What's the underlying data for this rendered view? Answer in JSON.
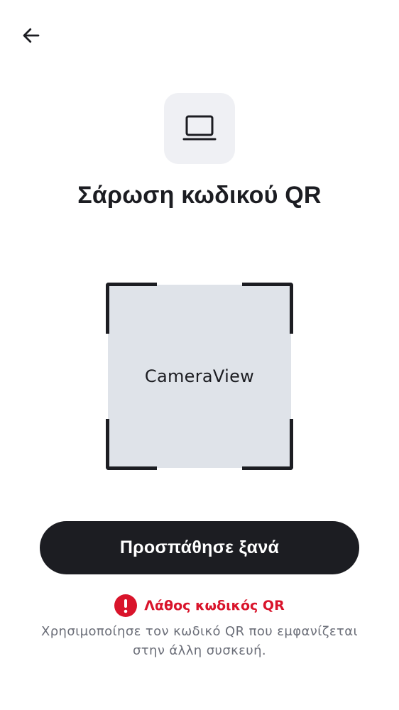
{
  "header": {
    "back_icon": "arrow-left-icon"
  },
  "device": {
    "icon": "laptop-icon",
    "tile_color": "#eff0f4"
  },
  "title": "Σάρωση κωδικού QR",
  "scanner": {
    "camera_label": "CameraView",
    "frame_color": "#1c1d22",
    "view_color": "#dfe3e9"
  },
  "retry_button": {
    "label": "Προσπάθησε ξανά",
    "color": "#1c1d22"
  },
  "error": {
    "icon": "exclamation-circle-icon",
    "message": "Λάθος κωδικός QR",
    "color": "#d9142b"
  },
  "helper": {
    "text": "Χρησιμοποίησε τον κωδικό QR που εμφανίζεται στην άλλη συσκευή."
  }
}
